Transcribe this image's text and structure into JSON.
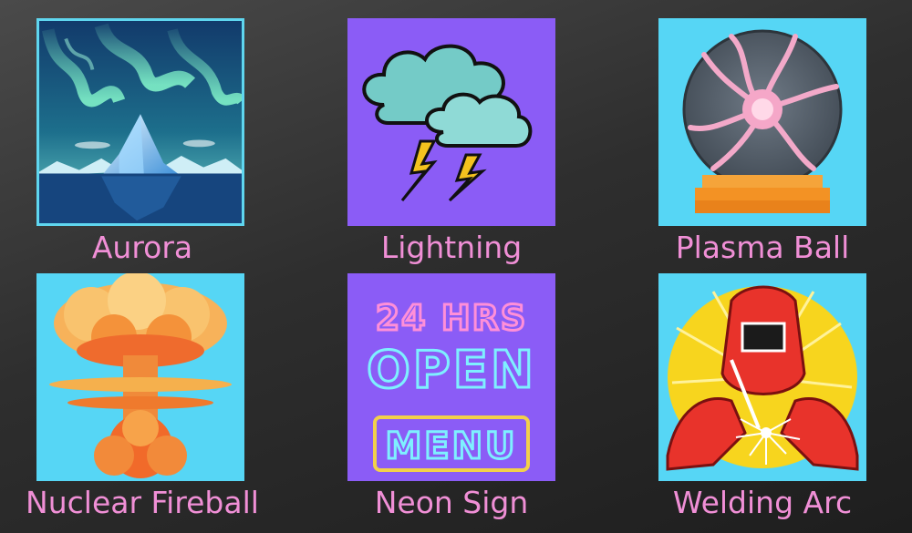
{
  "tiles": [
    {
      "label": "Aurora"
    },
    {
      "label": "Lightning"
    },
    {
      "label": "Plasma Ball"
    },
    {
      "label": "Nuclear Fireball"
    },
    {
      "label": "Neon Sign"
    },
    {
      "label": "Welding Arc"
    }
  ],
  "neon_sign": {
    "line1": "24 HRS",
    "line2": "OPEN",
    "line3": "MENU"
  },
  "colors": {
    "label": "#f08fd6",
    "purple_bg": "#8b5cf6",
    "cyan_bg": "#56d6f5"
  }
}
